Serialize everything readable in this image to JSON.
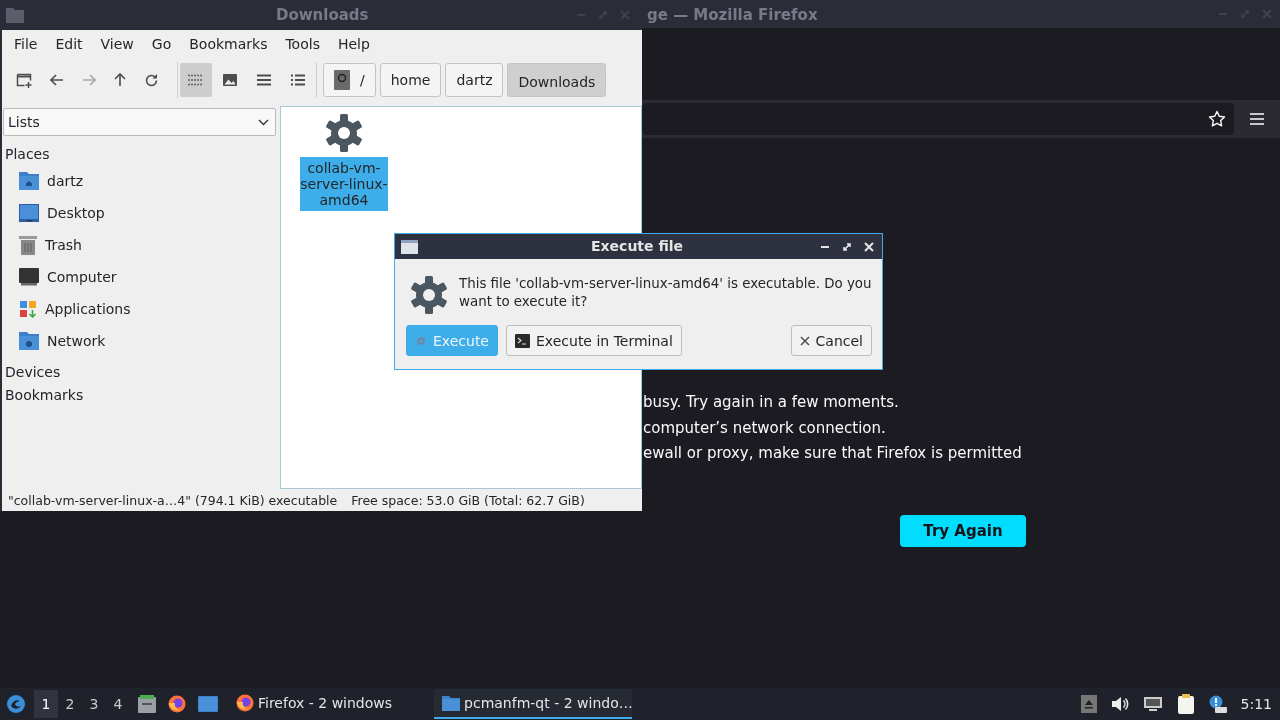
{
  "firefox_window": {
    "title": "ge — Mozilla Firefox",
    "error_lines": [
      "busy. Try again in a few moments.",
      "computer’s network connection.",
      "ewall or proxy, make sure that Firefox is permitted"
    ],
    "try_again_button": "Try Again"
  },
  "file_manager": {
    "title": "Downloads",
    "menu": [
      "File",
      "Edit",
      "View",
      "Go",
      "Bookmarks",
      "Tools",
      "Help"
    ],
    "view_modes": [
      {
        "kind": "icons",
        "selected": true
      },
      {
        "kind": "thumbnails",
        "selected": false
      },
      {
        "kind": "compact",
        "selected": false
      },
      {
        "kind": "detailed",
        "selected": false
      }
    ],
    "path": [
      {
        "label": "/",
        "kind": "root",
        "selected": false
      },
      {
        "label": "home",
        "kind": "dir",
        "selected": false
      },
      {
        "label": "dartz",
        "kind": "dir",
        "selected": false
      },
      {
        "label": "Downloads",
        "kind": "dir",
        "selected": true
      }
    ],
    "side_pane_mode": "Lists",
    "places_heading": "Places",
    "places": [
      {
        "label": "dartz",
        "kind": "home"
      },
      {
        "label": "Desktop",
        "kind": "desktop"
      },
      {
        "label": "Trash",
        "kind": "trash"
      },
      {
        "label": "Computer",
        "kind": "computer"
      },
      {
        "label": "Applications",
        "kind": "applications"
      },
      {
        "label": "Network",
        "kind": "network"
      }
    ],
    "other_sections": [
      "Devices",
      "Bookmarks"
    ],
    "files": [
      {
        "name": "collab-vm-server-linux-amd64",
        "selected": true
      }
    ],
    "status_left": "\"collab-vm-server-linux-a…4\" (794.1 KiB) executable",
    "status_right": "Free space: 53.0 GiB (Total: 62.7 GiB)"
  },
  "dialog": {
    "title": "Execute file",
    "message": "This file 'collab-vm-server-linux-amd64' is executable. Do you want to execute it?",
    "buttons": [
      {
        "label": "Execute",
        "kind": "execute",
        "default": true
      },
      {
        "label": "Execute in Terminal",
        "kind": "terminal",
        "default": false
      },
      {
        "label": "Cancel",
        "kind": "cancel",
        "default": false
      }
    ]
  },
  "taskbar": {
    "workspaces": [
      {
        "label": "1",
        "selected": true
      },
      {
        "label": "2",
        "selected": false
      },
      {
        "label": "3",
        "selected": false
      },
      {
        "label": "4",
        "selected": false
      }
    ],
    "tasks": [
      {
        "label": "Firefox - 2 windows",
        "kind": "firefox",
        "selected": false
      },
      {
        "label": "pcmanfm-qt - 2 windo…",
        "kind": "folder",
        "selected": true
      }
    ],
    "clock": "5:11"
  }
}
